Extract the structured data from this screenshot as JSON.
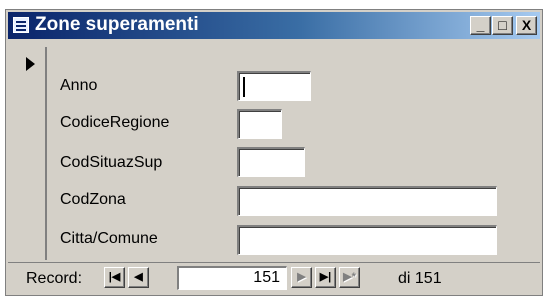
{
  "window": {
    "title": "Zone superamenti"
  },
  "title_buttons": {
    "minimize": "_",
    "maximize": "□",
    "close": "X"
  },
  "fields": [
    {
      "label": "Anno",
      "value": ""
    },
    {
      "label": "CodiceRegione",
      "value": ""
    },
    {
      "label": "CodSituazSup",
      "value": ""
    },
    {
      "label": "CodZona",
      "value": ""
    },
    {
      "label": "Citta/Comune",
      "value": ""
    }
  ],
  "navigation": {
    "record_label": "Record:",
    "current_record": "151",
    "total_text": "di 151",
    "first_icon": "first-record-icon",
    "prev_icon": "previous-record-icon",
    "next_icon": "next-record-icon",
    "last_icon": "last-record-icon",
    "new_icon": "new-record-icon"
  },
  "colors": {
    "titlebar_start": "#0a246a",
    "titlebar_end": "#a6caf0",
    "face": "#d4d0c8"
  }
}
